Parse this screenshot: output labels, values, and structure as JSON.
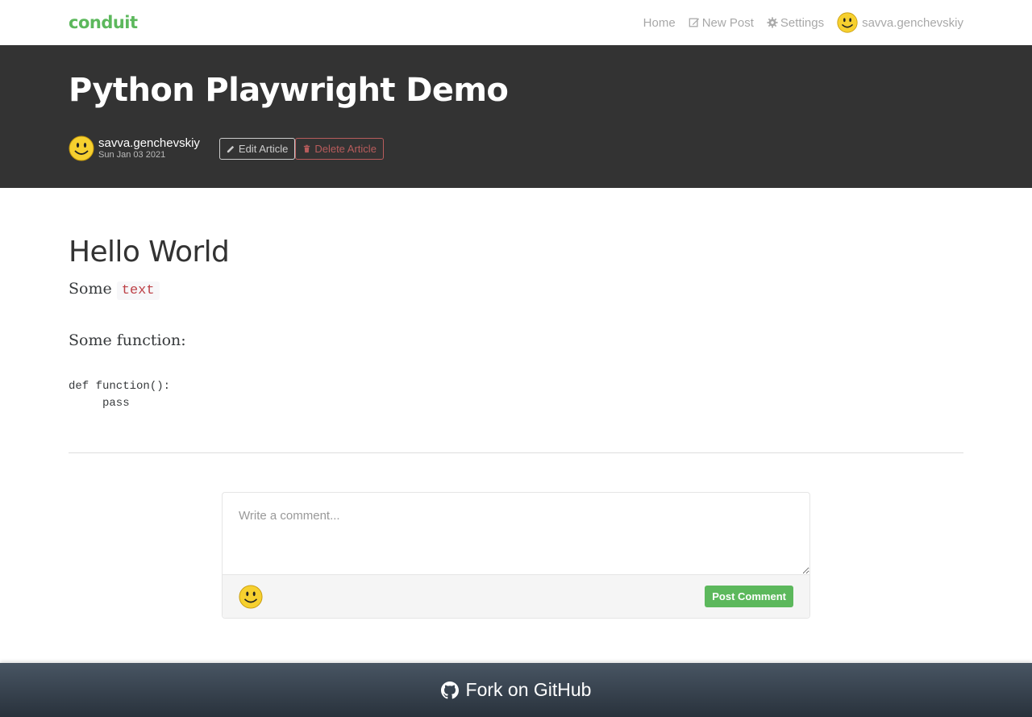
{
  "nav": {
    "brand": "conduit",
    "items": [
      {
        "label": "Home",
        "icon": "home"
      },
      {
        "label": "New Post",
        "icon": "compose-icon"
      },
      {
        "label": "Settings",
        "icon": "gear-icon"
      },
      {
        "label": "savva.genchevskiy",
        "icon": "avatar"
      }
    ]
  },
  "article": {
    "title": "Python Playwright Demo",
    "author": "savva.genchevskiy",
    "date": "Sun Jan 03 2021",
    "edit_label": "Edit Article",
    "delete_label": "Delete Article",
    "heading": "Hello World",
    "para1_text": "Some",
    "para1_code": "text",
    "para2_text": "Some function:",
    "code_block": "def function():\n     pass"
  },
  "comment": {
    "placeholder": "Write a comment...",
    "post_label": "Post Comment"
  },
  "footer": {
    "label": "Fork on GitHub"
  },
  "colors": {
    "brand_green": "#5cb85c",
    "banner_bg": "#333333",
    "danger": "#b85c5c"
  }
}
